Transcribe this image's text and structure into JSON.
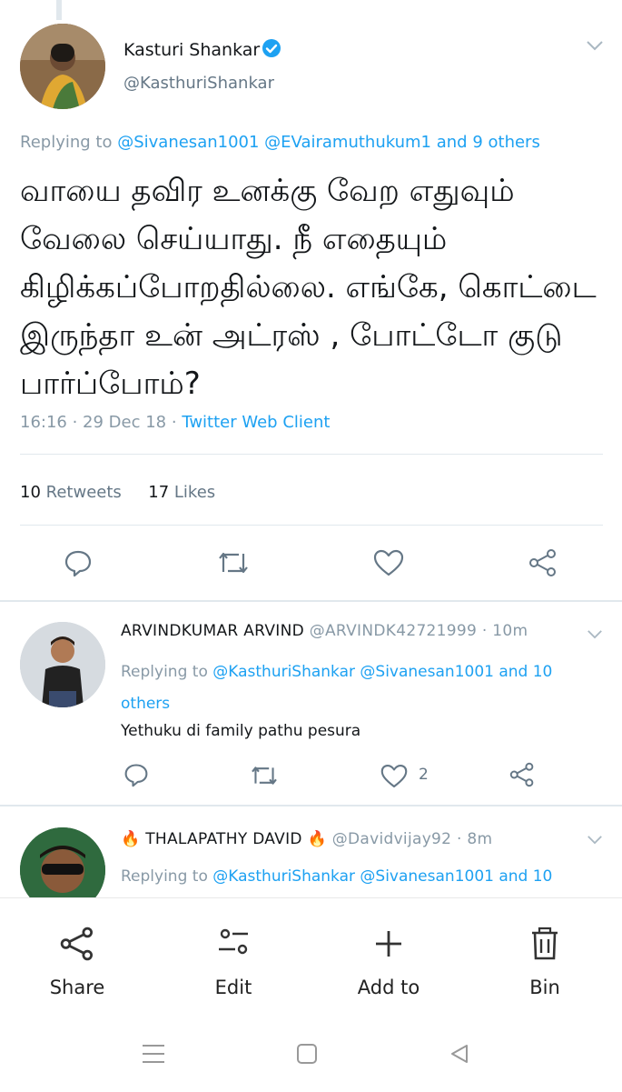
{
  "tweet": {
    "display_name": "Kasturi Shankar",
    "handle": "@KasthuriShankar",
    "replying_prefix": "Replying to",
    "replying_users": "@Sivanesan1001 @EVairamuthukum1",
    "replying_others": "and 9 others",
    "text": "வாயை தவிர உனக்கு வேற எதுவும் வேலை செய்யாது. நீ எதையும் கிழிக்கப்போறதில்லை. எங்கே, கொட்டை இருந்தா உன் அட்ரஸ் , போட்டோ குடு பார்ப்போம்?",
    "time": "16:16 · 29 Dec 18 ·",
    "client": "Twitter Web Client",
    "retweets_count": "10",
    "retweets_label": "Retweets",
    "likes_count": "17",
    "likes_label": "Likes"
  },
  "replies": [
    {
      "display_name": "ARVINDKUMAR ARVIND",
      "handle": "@ARVINDK42721999",
      "time": "· 10m",
      "replying_prefix": "Replying to",
      "replying_users": "@KasthuriShankar @Sivanesan1001 and 10",
      "replying_users_line2": "others",
      "text": "Yethuku di family pathu pesura",
      "like_count": "2"
    },
    {
      "display_name": "THALAPATHY DAVID",
      "emoji": "🔥",
      "handle": "@Davidvijay92",
      "time": "· 8m",
      "replying_prefix": "Replying to",
      "replying_users": "@KasthuriShankar @Sivanesan1001 and 10"
    }
  ],
  "bottom_bar": {
    "share": "Share",
    "edit": "Edit",
    "add_to": "Add to",
    "bin": "Bin"
  },
  "colors": {
    "link": "#1da1f2",
    "verified": "#1da1f2",
    "muted": "#8899a6",
    "divider": "#e1e8ed"
  },
  "icons": [
    "verified-icon",
    "chevron-down-icon",
    "reply-icon",
    "retweet-icon",
    "like-icon",
    "share-icon",
    "edit-icon",
    "add-icon",
    "bin-icon",
    "menu-icon",
    "home-icon",
    "back-icon"
  ]
}
